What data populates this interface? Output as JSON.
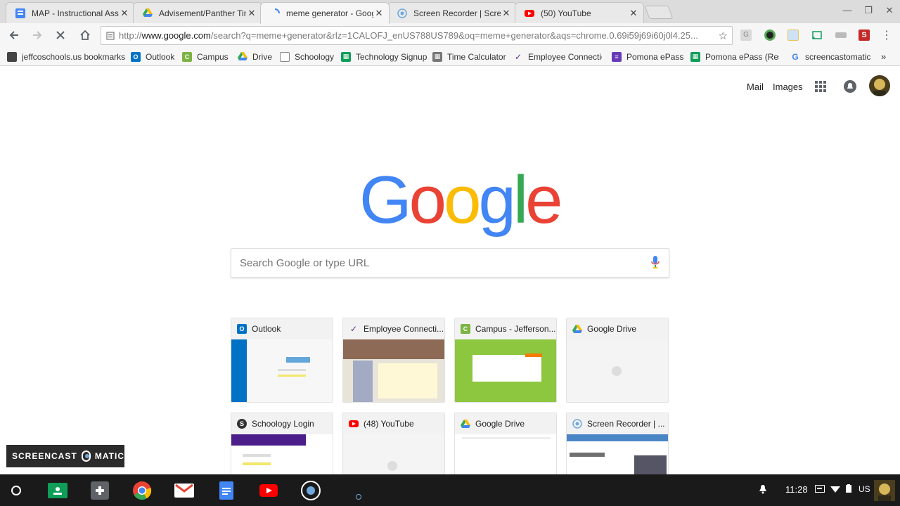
{
  "tabs": [
    {
      "title": "MAP - Instructional Ass",
      "icon": "docs-form-icon",
      "active": false
    },
    {
      "title": "Advisement/Panther Tin",
      "icon": "drive-icon",
      "active": false
    },
    {
      "title": "meme generator - Googl",
      "icon": "loading-spinner-icon",
      "active": true
    },
    {
      "title": "Screen Recorder | Scree",
      "icon": "screencast-icon",
      "active": false
    },
    {
      "title": "(50) YouTube",
      "icon": "youtube-icon",
      "active": false
    }
  ],
  "toolbar": {
    "url_scheme": "http://",
    "url_host": "www.google.com",
    "url_rest": "/search?q=meme+generator&rlz=1CALOFJ_enUS788US789&oq=meme+generator&aqs=chrome.0.69i59j69i60j0l4.25..."
  },
  "bookmarks": [
    {
      "label": "jeffcoschools.us bookmarks",
      "icon": "folder-icon"
    },
    {
      "label": "Outlook",
      "icon": "outlook-icon"
    },
    {
      "label": "Campus",
      "icon": "campus-icon"
    },
    {
      "label": "Drive",
      "icon": "drive-icon"
    },
    {
      "label": "Schoology",
      "icon": "page-icon"
    },
    {
      "label": "Technology Signup",
      "icon": "sheets-icon"
    },
    {
      "label": "Time Calculator",
      "icon": "calculator-icon"
    },
    {
      "label": "Employee Connectio",
      "icon": "jeffco-icon"
    },
    {
      "label": "Pomona ePass",
      "icon": "forms-icon"
    },
    {
      "label": "Pomona ePass (Resp",
      "icon": "sheets-icon"
    },
    {
      "label": "screencastomatic",
      "icon": "google-icon"
    }
  ],
  "ntp": {
    "mail": "Mail",
    "images": "Images",
    "logo": "Google",
    "search_placeholder": "Search Google or type URL",
    "tiles": [
      {
        "title": "Outlook",
        "icon": "outlook-icon"
      },
      {
        "title": "Employee Connecti...",
        "icon": "jeffco-icon"
      },
      {
        "title": "Campus - Jefferson...",
        "icon": "campus-icon"
      },
      {
        "title": "Google Drive",
        "icon": "drive-icon"
      },
      {
        "title": "Schoology Login",
        "icon": "schoology-icon"
      },
      {
        "title": "(48) YouTube",
        "icon": "youtube-icon"
      },
      {
        "title": "Google Drive",
        "icon": "drive-icon"
      },
      {
        "title": "Screen Recorder | ...",
        "icon": "screencast-icon"
      }
    ]
  },
  "watermark": {
    "left": "SCREENCAST",
    "right": "MATIC"
  },
  "shelf": {
    "time": "11:28",
    "locale": "US"
  },
  "colors": {
    "g_blue": "#4285F4",
    "g_red": "#EA4335",
    "g_yellow": "#FBBC05",
    "g_green": "#34A853",
    "shelf_bg": "#1a1a1a"
  }
}
